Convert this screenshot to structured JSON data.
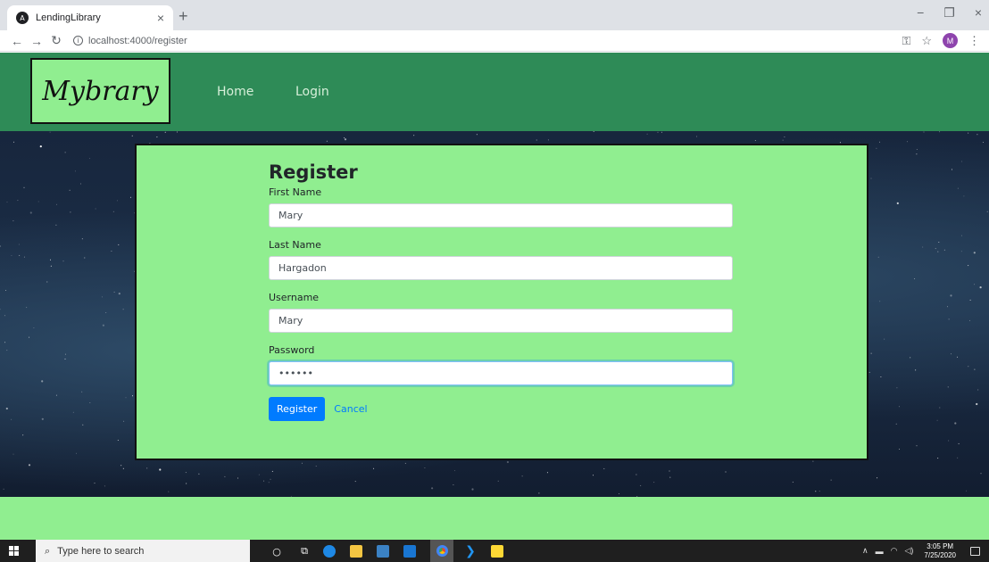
{
  "browser": {
    "tab_title": "LendingLibrary",
    "tab_close": "×",
    "new_tab": "+",
    "url": "localhost:4000/register",
    "window_controls": [
      "−",
      "❐",
      "×"
    ],
    "profile_initial": "M"
  },
  "navbar": {
    "brand": "Mybrary",
    "links": [
      {
        "label": "Home"
      },
      {
        "label": "Login"
      }
    ]
  },
  "form": {
    "title": "Register",
    "fields": [
      {
        "label": "First Name",
        "value": "Mary",
        "type": "text"
      },
      {
        "label": "Last Name",
        "value": "Hargadon",
        "type": "text"
      },
      {
        "label": "Username",
        "value": "Mary",
        "type": "text"
      },
      {
        "label": "Password",
        "value": "mary12",
        "type": "password"
      }
    ],
    "submit_label": "Register",
    "cancel_label": "Cancel"
  },
  "taskbar": {
    "search_placeholder": "Type here to search",
    "time": "3:05 PM",
    "date": "7/25/2020"
  },
  "colors": {
    "navbar": "#2e8b57",
    "card": "#90ee90",
    "primary": "#007bff"
  }
}
